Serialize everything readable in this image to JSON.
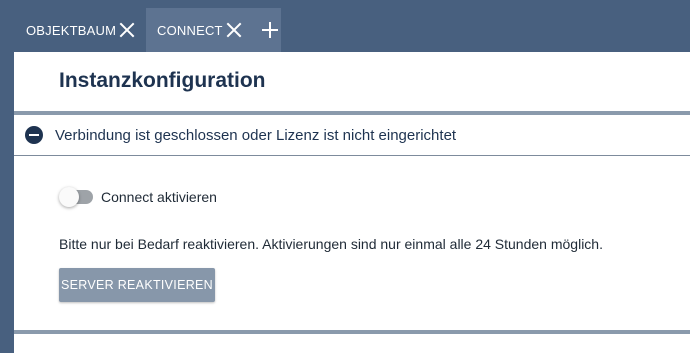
{
  "tabs": [
    {
      "label": "OBJEKTBAUM",
      "active": false,
      "close_icon": "close-icon"
    },
    {
      "label": "CONNECT",
      "active": true,
      "close_icon": "close-icon"
    }
  ],
  "add_tab_icon": "plus-icon",
  "page": {
    "title": "Instanzkonfiguration"
  },
  "section": {
    "icon": "minus-circle-icon",
    "text": "Verbindung ist geschlossen oder Lizenz ist nicht eingerichtet"
  },
  "toggle": {
    "label": "Connect aktivieren",
    "checked": false
  },
  "hint": "Bitte nur bei Bedarf reaktivieren. Aktivierungen sind nur einmal alle 24 Stunden möglich.",
  "reactivate_button": {
    "label": "SERVER REAKTIVIEREN"
  },
  "colors": {
    "header_bg": "#48607f",
    "active_tab_bg": "#5d7391",
    "title_text": "#1e3350",
    "button_bg": "#8797aa",
    "rule": "#8a9aac"
  }
}
